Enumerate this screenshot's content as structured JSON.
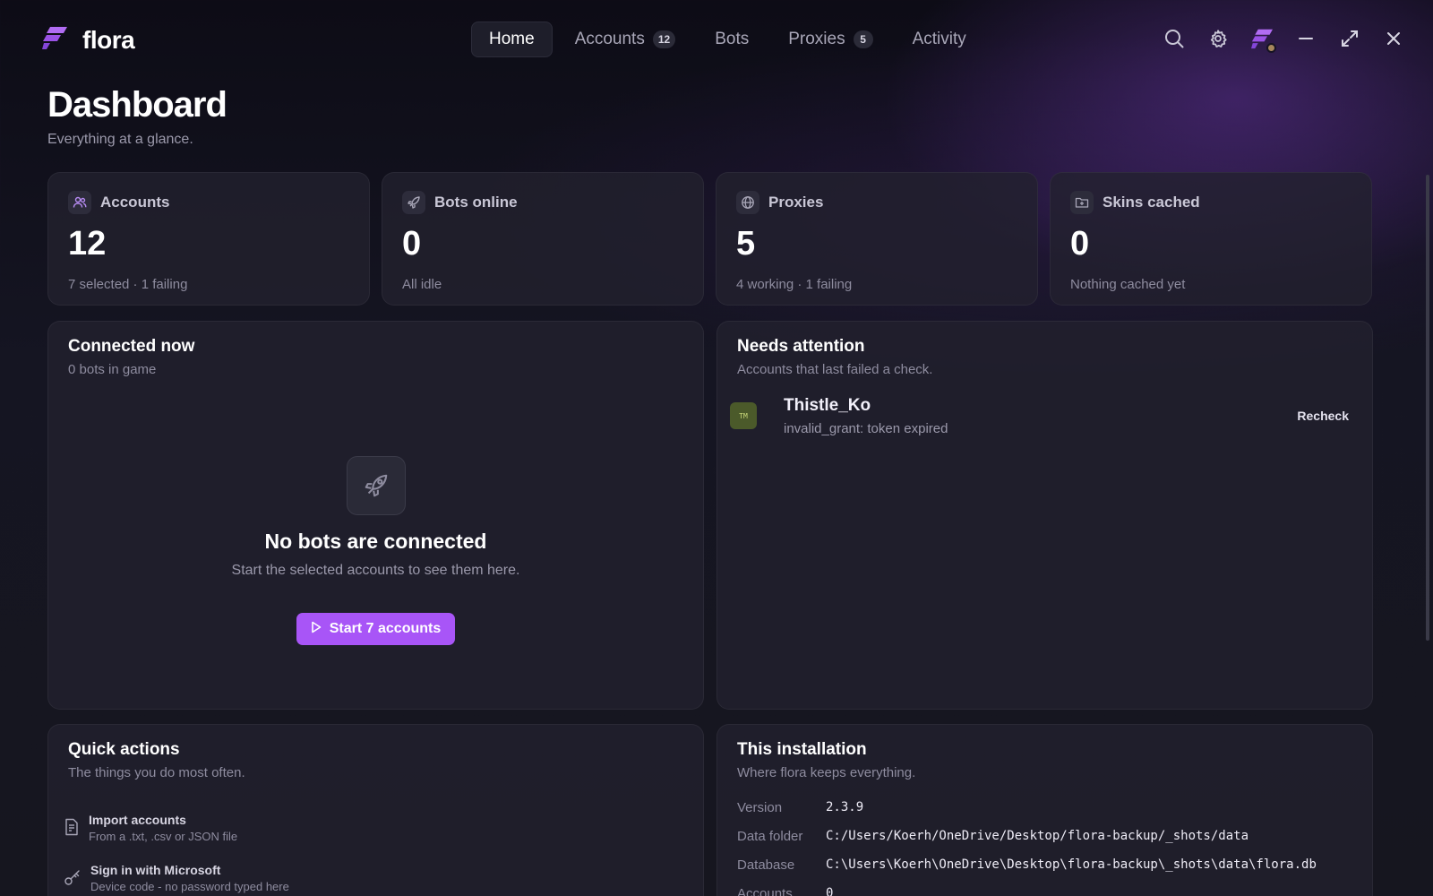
{
  "app": {
    "name": "flora"
  },
  "nav": {
    "tabs": [
      {
        "label": "Home",
        "badge": null,
        "active": true
      },
      {
        "label": "Accounts",
        "badge": "12",
        "active": false
      },
      {
        "label": "Bots",
        "badge": null,
        "active": false
      },
      {
        "label": "Proxies",
        "badge": "5",
        "active": false
      },
      {
        "label": "Activity",
        "badge": null,
        "active": false
      }
    ]
  },
  "window_controls": [
    "search-icon",
    "gear-icon",
    "avatar",
    "minimize-icon",
    "maximize-icon",
    "close-icon"
  ],
  "page": {
    "title": "Dashboard",
    "subtitle": "Everything at a glance."
  },
  "stats": [
    {
      "label": "Accounts",
      "value": "12",
      "sub": "7 selected · 1 failing",
      "icon": "users-icon"
    },
    {
      "label": "Bots online",
      "value": "0",
      "sub": "All idle",
      "icon": "rocket-icon"
    },
    {
      "label": "Proxies",
      "value": "5",
      "sub": "4 working · 1 failing",
      "icon": "globe-icon"
    },
    {
      "label": "Skins cached",
      "value": "0",
      "sub": "Nothing cached yet",
      "icon": "folder-icon"
    }
  ],
  "connected": {
    "title": "Connected now",
    "subtitle": "0 bots in game",
    "empty_title": "No bots are connected",
    "empty_sub": "Start the selected accounts to see them here.",
    "button": "Start 7 accounts"
  },
  "attention": {
    "title": "Needs attention",
    "subtitle": "Accounts that last failed a check.",
    "items": [
      {
        "avatar": "TM",
        "name": "Thistle_Ko",
        "error": "invalid_grant: token expired",
        "action": "Recheck"
      }
    ]
  },
  "quick_actions": {
    "title": "Quick actions",
    "subtitle": "The things you do most often.",
    "items": [
      {
        "label": "Import accounts",
        "desc": "From a .txt, .csv or JSON file",
        "icon": "file-import-icon"
      },
      {
        "label": "Sign in with Microsoft",
        "desc": "Device code - no password typed here",
        "icon": "key-icon"
      }
    ]
  },
  "installation": {
    "title": "This installation",
    "subtitle": "Where flora keeps everything.",
    "rows": [
      {
        "key": "Version",
        "value": "2.3.9"
      },
      {
        "key": "Data folder",
        "value": "C:/Users/Koerh/OneDrive/Desktop/flora-backup/_shots/data"
      },
      {
        "key": "Database",
        "value": "C:\\Users\\Koerh\\OneDrive\\Desktop\\flora-backup\\_shots\\data\\flora.db"
      },
      {
        "key": "Accounts",
        "value": "0"
      }
    ]
  },
  "colors": {
    "accent": "#a855f7",
    "background": "#16161f",
    "card": "#22212e",
    "status_dot": "#a6875c"
  }
}
